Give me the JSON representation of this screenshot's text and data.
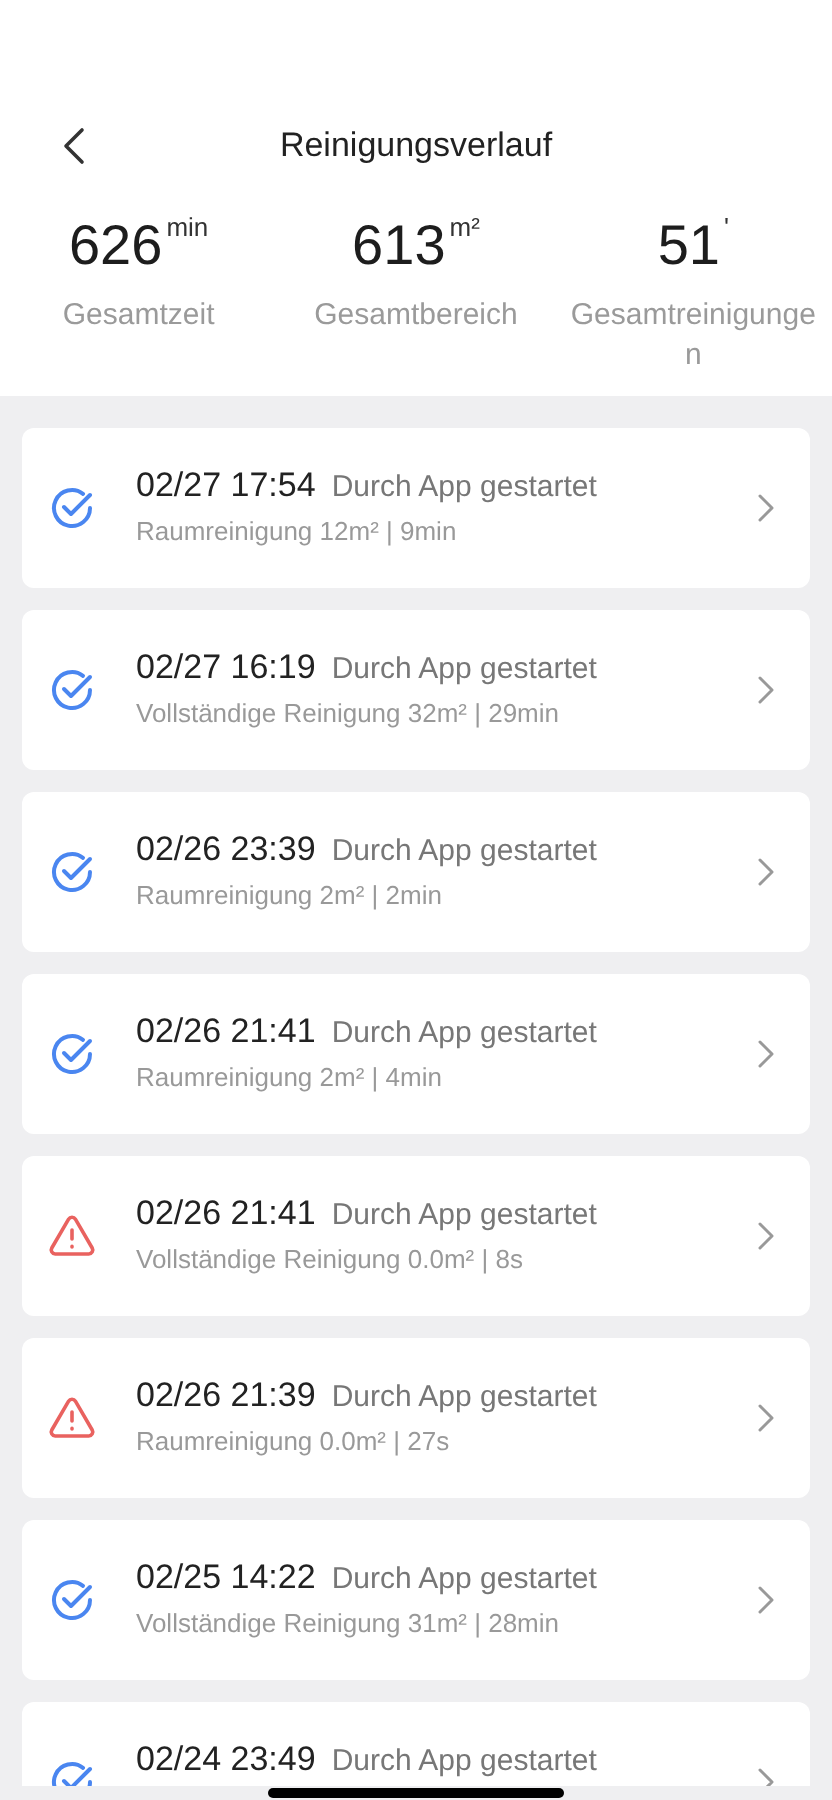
{
  "header": {
    "title": "Reinigungsverlauf"
  },
  "stats": [
    {
      "value": "626",
      "unit": "min",
      "label": "Gesamtzeit"
    },
    {
      "value": "613",
      "unit": "m²",
      "label": "Gesamtbereich"
    },
    {
      "value": "51",
      "unit": "'",
      "label": "Gesamtreinigungen"
    }
  ],
  "records": [
    {
      "kind": "done",
      "time": "02/27 17:54",
      "source": "Durch App gestartet",
      "detail": "Raumreinigung 12m² | 9min"
    },
    {
      "kind": "done",
      "time": "02/27 16:19",
      "source": "Durch App gestartet",
      "detail": "Vollständige Reinigung 32m² | 29min"
    },
    {
      "kind": "done",
      "time": "02/26 23:39",
      "source": "Durch App gestartet",
      "detail": "Raumreinigung 2m² | 2min"
    },
    {
      "kind": "done",
      "time": "02/26 21:41",
      "source": "Durch App gestartet",
      "detail": "Raumreinigung 2m² | 4min"
    },
    {
      "kind": "error",
      "time": "02/26 21:41",
      "source": "Durch App gestartet",
      "detail": "Vollständige Reinigung 0.0m² | 8s"
    },
    {
      "kind": "error",
      "time": "02/26 21:39",
      "source": "Durch App gestartet",
      "detail": "Raumreinigung 0.0m² | 27s"
    },
    {
      "kind": "done",
      "time": "02/25 14:22",
      "source": "Durch App gestartet",
      "detail": "Vollständige Reinigung 31m² | 28min"
    },
    {
      "kind": "done",
      "time": "02/24 23:49",
      "source": "Durch App gestartet"
    }
  ]
}
